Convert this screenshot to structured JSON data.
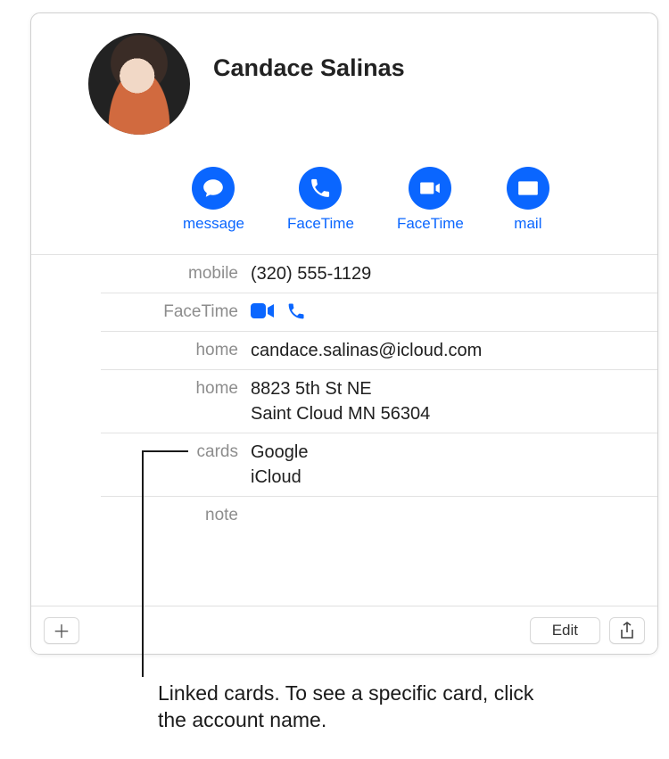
{
  "contact": {
    "name": "Candace Salinas"
  },
  "actions": {
    "message": "message",
    "facetime_video": "FaceTime",
    "facetime_audio": "FaceTime",
    "mail": "mail"
  },
  "fields": {
    "mobile_label": "mobile",
    "mobile_value": "(320) 555-1129",
    "facetime_label": "FaceTime",
    "email_label": "home",
    "email_value": "candace.salinas@icloud.com",
    "address_label": "home",
    "address_line1": "8823 5th St NE",
    "address_line2": "Saint Cloud MN 56304",
    "cards_label": "cards",
    "cards": [
      "Google",
      "iCloud"
    ],
    "note_label": "note",
    "note_value": ""
  },
  "buttons": {
    "edit": "Edit"
  },
  "caption": "Linked cards. To see a specific card, click the account name."
}
